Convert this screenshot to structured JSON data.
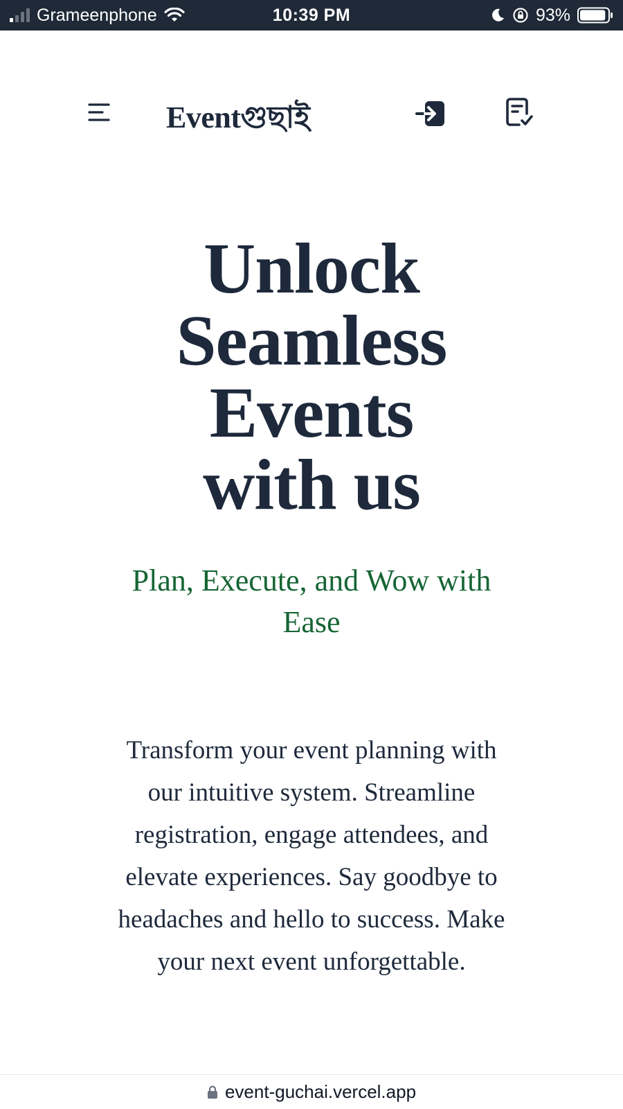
{
  "status_bar": {
    "carrier": "Grameenphone",
    "time": "10:39 PM",
    "battery": "93%",
    "battery_level": 0.93,
    "icons": [
      "signal-icon",
      "wifi-icon",
      "moon-icon",
      "rotation-lock-icon",
      "battery-icon"
    ]
  },
  "header": {
    "logo": "Eventগুছাই",
    "icons": [
      "menu-icon",
      "login-icon",
      "clipboard-check-icon"
    ]
  },
  "hero": {
    "title_lines": [
      "Unlock",
      "Seamless",
      "Events",
      "with us"
    ],
    "subtitle": "Plan, Execute, and Wow with Ease",
    "description": "Transform your event planning with our intuitive system. Streamline registration, engage attendees, and elevate experiences. Say goodbye to headaches and hello to success. Make your next event unforgettable."
  },
  "browser": {
    "url": "event-guchai.vercel.app",
    "icons": [
      "lock-icon"
    ]
  },
  "colors": {
    "text": "#1e293b",
    "accent_green": "#166534",
    "status_bar_bg": "#1f2937"
  }
}
